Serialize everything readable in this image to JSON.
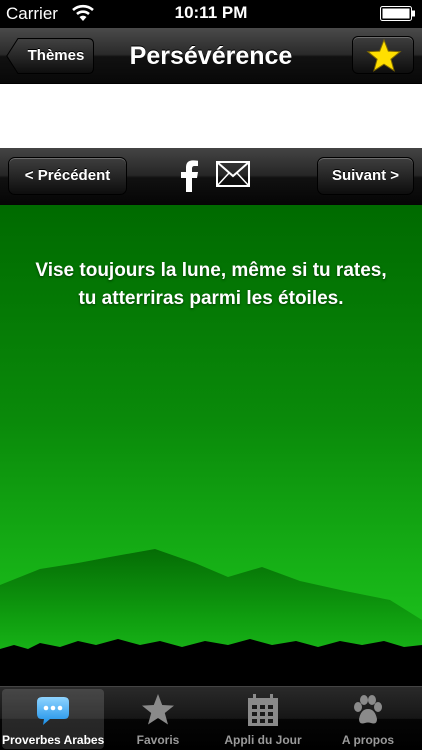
{
  "status_bar": {
    "carrier": "Carrier",
    "time": "10:11 PM"
  },
  "nav": {
    "back_label": "Thèmes",
    "title": "Persévérence",
    "favorite_icon": "star-icon",
    "star_color": "#ffdf00"
  },
  "toolbar": {
    "prev_label": "< Précédent",
    "next_label": "Suivant >",
    "share_icons": [
      "facebook-icon",
      "mail-icon"
    ]
  },
  "quote": {
    "text_line1": "Vise toujours la lune, même si tu rates,",
    "text_line2": "tu atterriras parmi les étoiles."
  },
  "colors": {
    "background_top": "#006a00",
    "background_bottom": "#20cc20",
    "mountains": "#006a00"
  },
  "tabs": [
    {
      "label": "Proverbes Arabes",
      "icon": "speech-bubble-icon",
      "active": true
    },
    {
      "label": "Favoris",
      "icon": "star-icon",
      "active": false
    },
    {
      "label": "Appli du Jour",
      "icon": "calendar-icon",
      "active": false
    },
    {
      "label": "A propos",
      "icon": "paw-icon",
      "active": false
    }
  ]
}
